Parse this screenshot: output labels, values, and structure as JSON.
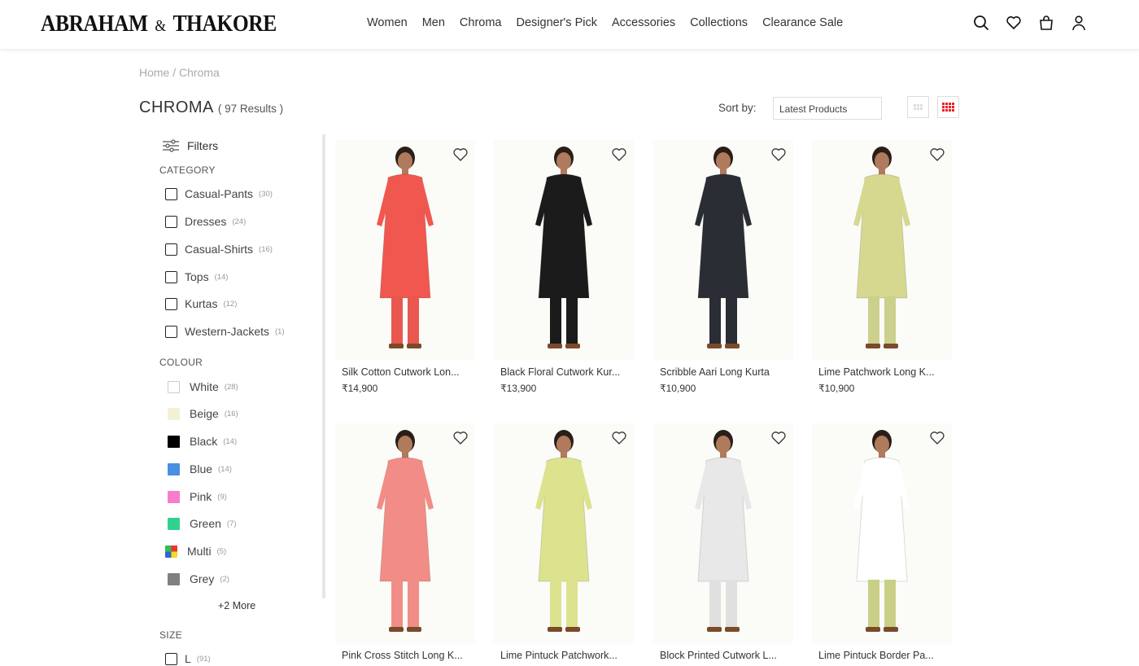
{
  "brand": {
    "logo_left": "ABRAHAM",
    "logo_amp": "&",
    "logo_right": "THAKORE"
  },
  "nav": [
    "Women",
    "Men",
    "Chroma",
    "Designer's Pick",
    "Accessories",
    "Collections",
    "Clearance Sale"
  ],
  "breadcrumb": "Home / Chroma",
  "page": {
    "title": "CHROMA",
    "results": "( 97 Results )"
  },
  "sort": {
    "label": "Sort by:",
    "value": "Latest Products"
  },
  "filters": {
    "heading": "Filters",
    "category_label": "CATEGORY",
    "categories": [
      {
        "label": "Casual-Pants",
        "count": "(30)"
      },
      {
        "label": "Dresses",
        "count": "(24)"
      },
      {
        "label": "Casual-Shirts",
        "count": "(16)"
      },
      {
        "label": "Tops",
        "count": "(14)"
      },
      {
        "label": "Kurtas",
        "count": "(12)"
      },
      {
        "label": "Western-Jackets",
        "count": "(1)"
      }
    ],
    "colour_label": "COLOUR",
    "colours": [
      {
        "label": "White",
        "count": "(28)",
        "color": "#ffffff"
      },
      {
        "label": "Beige",
        "count": "(16)",
        "color": "#f3f1d6"
      },
      {
        "label": "Black",
        "count": "(14)",
        "color": "#000000"
      },
      {
        "label": "Blue",
        "count": "(14)",
        "color": "#4a8fe2"
      },
      {
        "label": "Pink",
        "count": "(9)",
        "color": "#f77ccb"
      },
      {
        "label": "Green",
        "count": "(7)",
        "color": "#33d18f"
      },
      {
        "label": "Multi",
        "count": "(5)",
        "color": "multi"
      },
      {
        "label": "Grey",
        "count": "(2)",
        "color": "#808080"
      }
    ],
    "more": "+2 More",
    "size_label": "SIZE",
    "sizes": [
      {
        "label": "L",
        "count": "(91)"
      }
    ]
  },
  "products": [
    {
      "name": "Silk Cotton Cutwork Lon...",
      "price": "₹14,900",
      "top": "#f0584f",
      "bottom": "#e9574f"
    },
    {
      "name": "Black Floral Cutwork Kur...",
      "price": "₹13,900",
      "top": "#1b1b1b",
      "bottom": "#1b1b1b"
    },
    {
      "name": "Scribble Aari Long Kurta",
      "price": "₹10,900",
      "top": "#2a2d33",
      "bottom": "#2a2d33"
    },
    {
      "name": "Lime Patchwork Long K...",
      "price": "₹10,900",
      "top": "#d5d88e",
      "bottom": "#cbd08c"
    },
    {
      "name": "Pink Cross Stitch Long K...",
      "price": "",
      "top": "#f18d86",
      "bottom": "#f18d86"
    },
    {
      "name": "Lime Pintuck Patchwork...",
      "price": "",
      "top": "#dde28e",
      "bottom": "#dde28e"
    },
    {
      "name": "Block Printed Cutwork L...",
      "price": "",
      "top": "#e8e8e8",
      "bottom": "#e0e0e0"
    },
    {
      "name": "Lime Pintuck Border Pa...",
      "price": "",
      "top": "#ffffff",
      "bottom": "#c9cf87"
    }
  ]
}
